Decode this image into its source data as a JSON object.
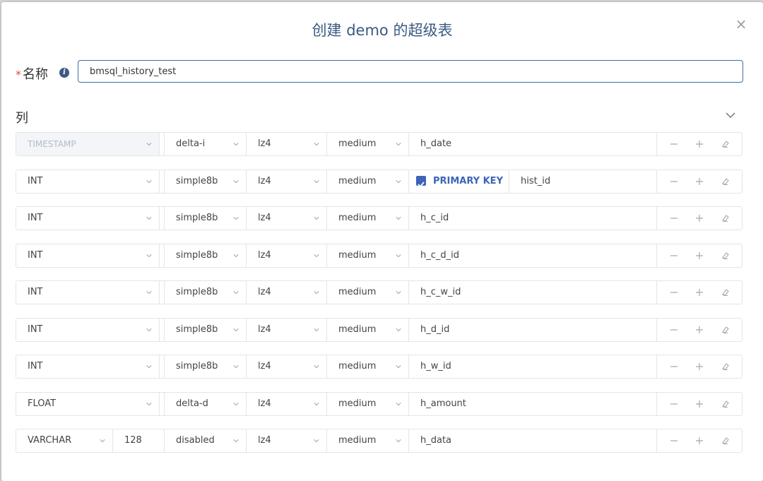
{
  "dialog": {
    "title": "创建 demo 的超级表",
    "close_icon": "close-icon"
  },
  "name_field": {
    "required_mark": "*",
    "label": "名称",
    "info_icon": "info-icon",
    "value": "bmsql_history_test"
  },
  "columns_section": {
    "title": "列",
    "collapse_icon": "chevron-down-icon"
  },
  "columns": [
    {
      "type": "TIMESTAMP",
      "encoding": "delta-i",
      "compression": "lz4",
      "level": "medium",
      "name": "h_date",
      "disabled": true
    },
    {
      "type": "INT",
      "encoding": "simple8b",
      "compression": "lz4",
      "level": "medium",
      "name": "hist_id",
      "primary_key": true,
      "primary_key_label": "PRIMARY KEY"
    },
    {
      "type": "INT",
      "encoding": "simple8b",
      "compression": "lz4",
      "level": "medium",
      "name": "h_c_id"
    },
    {
      "type": "INT",
      "encoding": "simple8b",
      "compression": "lz4",
      "level": "medium",
      "name": "h_c_d_id"
    },
    {
      "type": "INT",
      "encoding": "simple8b",
      "compression": "lz4",
      "level": "medium",
      "name": "h_c_w_id"
    },
    {
      "type": "INT",
      "encoding": "simple8b",
      "compression": "lz4",
      "level": "medium",
      "name": "h_d_id"
    },
    {
      "type": "INT",
      "encoding": "simple8b",
      "compression": "lz4",
      "level": "medium",
      "name": "h_w_id"
    },
    {
      "type": "FLOAT",
      "encoding": "delta-d",
      "compression": "lz4",
      "level": "medium",
      "name": "h_amount"
    },
    {
      "type": "VARCHAR",
      "length": "128",
      "encoding": "disabled",
      "compression": "lz4",
      "level": "medium",
      "name": "h_data"
    }
  ],
  "row_actions": {
    "remove_icon": "minus-icon",
    "add_icon": "plus-icon",
    "clear_icon": "eraser-icon"
  },
  "colors": {
    "title": "#3a5a82",
    "accent": "#3d64b8",
    "required": "#e04a4a",
    "border": "#e3e5e8"
  }
}
